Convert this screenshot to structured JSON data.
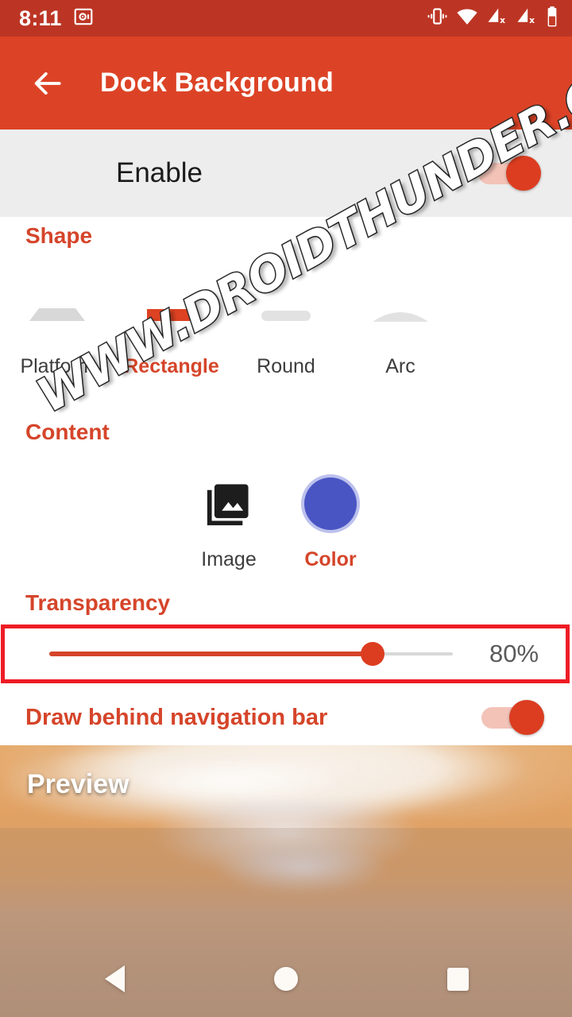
{
  "status_bar": {
    "time": "8:11",
    "icons": [
      {
        "name": "safe-box-icon",
        "glyph": "safe"
      },
      {
        "name": "vibrate-icon",
        "glyph": "vibrate"
      },
      {
        "name": "wifi-icon",
        "glyph": "wifi"
      },
      {
        "name": "signal-no-sim-1-icon",
        "glyph": "signal-x"
      },
      {
        "name": "signal-no-sim-2-icon",
        "glyph": "signal-x"
      },
      {
        "name": "battery-icon",
        "glyph": "battery"
      }
    ],
    "background_color": "#bc3524"
  },
  "app_bar": {
    "title": "Dock Background",
    "back_label": "Back",
    "background_color": "#dc4326"
  },
  "enable_row": {
    "label": "Enable",
    "toggle_state": "on",
    "background_color": "#ededed"
  },
  "shape_section": {
    "title": "Shape",
    "selected": "Rectangle",
    "options": [
      {
        "label": "Platform",
        "icon": "platform-shape-icon",
        "selected": false
      },
      {
        "label": "Rectangle",
        "icon": "rectangle-shape-icon",
        "selected": true
      },
      {
        "label": "Round",
        "icon": "round-shape-icon",
        "selected": false
      },
      {
        "label": "Arc",
        "icon": "arc-shape-icon",
        "selected": false
      }
    ]
  },
  "content_section": {
    "title": "Content",
    "selected": "Color",
    "options": [
      {
        "label": "Image",
        "icon": "image-icon",
        "selected": false
      },
      {
        "label": "Color",
        "icon": "color-swatch-icon",
        "selected": true,
        "color": "#4a55c4"
      }
    ]
  },
  "transparency_section": {
    "title": "Transparency",
    "value": "80%",
    "percent": 80,
    "highlight_color": "#ee1c25"
  },
  "draw_behind_row": {
    "label": "Draw behind navigation bar",
    "toggle_state": "on"
  },
  "preview": {
    "label": "Preview"
  },
  "nav_bar": {
    "back_label": "Back",
    "home_label": "Home",
    "recents_label": "Recents"
  },
  "watermark": {
    "text": "WWW.DROIDTHUNDER.COM"
  },
  "theme": {
    "accent": "#d5452a",
    "primary": "#dc4326",
    "primary_dark": "#bc3524"
  }
}
